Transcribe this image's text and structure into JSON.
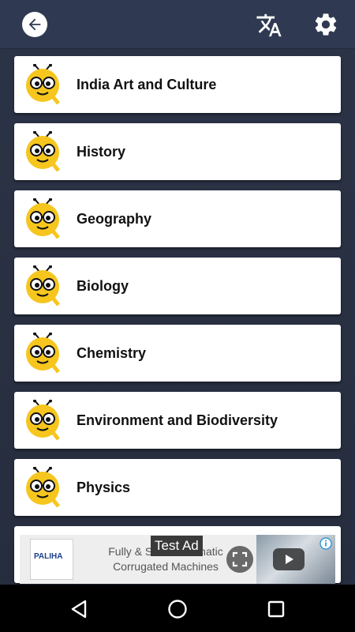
{
  "app_bar": {
    "back_icon": "arrow-left-icon",
    "translate_icon": "translate-icon",
    "settings_icon": "gear-icon"
  },
  "categories": [
    {
      "label": "India Art and Culture",
      "icon": "bee-quiz-icon"
    },
    {
      "label": "History",
      "icon": "bee-quiz-icon"
    },
    {
      "label": "Geography",
      "icon": "bee-quiz-icon"
    },
    {
      "label": "Biology",
      "icon": "bee-quiz-icon"
    },
    {
      "label": "Chemistry",
      "icon": "bee-quiz-icon"
    },
    {
      "label": "Environment and Biodiversity",
      "icon": "bee-quiz-icon"
    },
    {
      "label": "Physics",
      "icon": "bee-quiz-icon"
    }
  ],
  "ad": {
    "badge": "Test Ad",
    "logo_text": "PALIHA",
    "line1": "Fully & Semi-Automatic",
    "line2": "Corrugated Machines"
  },
  "colors": {
    "app_bar": "#2f3a52",
    "background": "#2b3346",
    "card": "#ffffff",
    "icon_yellow": "#f6c61e"
  },
  "nav": {
    "back": "triangle-back-icon",
    "home": "circle-home-icon",
    "recents": "square-recents-icon"
  }
}
